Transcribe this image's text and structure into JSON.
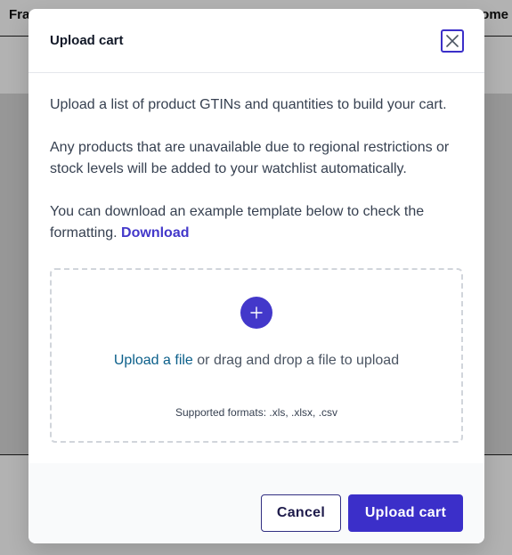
{
  "background": {
    "header_left": "Fra",
    "header_right": "ome"
  },
  "modal": {
    "title": "Upload cart",
    "close_icon": "close-icon",
    "paragraphs": [
      "Upload a list of product GTINs and quantities to build your cart.",
      "Any products that are unavailable due to regional restrictions or stock levels will be added to your watchlist automatically.",
      "You can download an example template below to check the formatting."
    ],
    "download_label": "Download",
    "dropzone": {
      "plus_icon": "plus-icon",
      "upload_link": "Upload a file",
      "upload_text": " or drag and drop a file to upload",
      "formats": "Supported formats: .xls, .xlsx, .csv"
    },
    "footer": {
      "cancel_label": "Cancel",
      "submit_label": "Upload cart"
    }
  },
  "colors": {
    "accent": "#3b2fc9",
    "link": "#4338ca",
    "upload_link": "#0b5f8a"
  }
}
